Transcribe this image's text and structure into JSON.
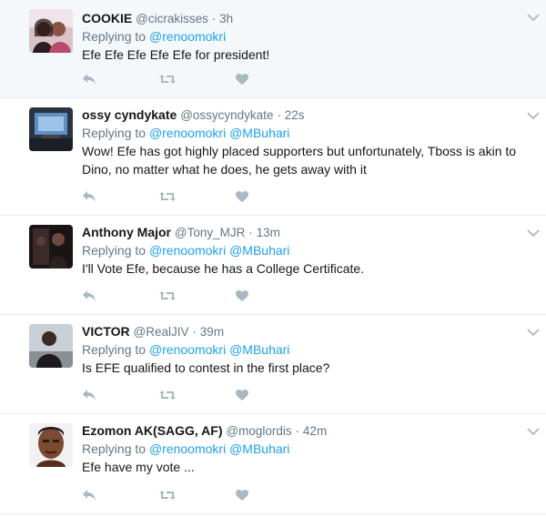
{
  "colors": {
    "link": "#1da1f2",
    "secondary": "#657786",
    "icon": "#aab8c2",
    "highlight_bg": "#f5f8fa"
  },
  "icons": {
    "reply": "reply-icon",
    "retweet": "retweet-icon",
    "like": "heart-icon",
    "more": "chevron-down-icon"
  },
  "tweets": [
    {
      "name": "COOKIE",
      "handle": "@cicrakisses",
      "separator": "·",
      "time": "3h",
      "replying_label": "Replying to",
      "mention1": "@renoomokri",
      "mention2": "",
      "text": "Efe Efe Efe Efe Efe for president!"
    },
    {
      "name": "ossy cyndykate",
      "handle": "@ossycyndykate",
      "separator": "·",
      "time": "22s",
      "replying_label": "Replying to",
      "mention1": "@renoomokri",
      "mention2": "@MBuhari",
      "text": "Wow! Efe has got highly placed supporters but unfortunately, Tboss is akin to Dino, no matter what he does, he gets away with it"
    },
    {
      "name": "Anthony Major",
      "handle": "@Tony_MJR",
      "separator": "·",
      "time": "13m",
      "replying_label": "Replying to",
      "mention1": "@renoomokri",
      "mention2": "@MBuhari",
      "text": "I'll Vote Efe, because he has a College Certificate."
    },
    {
      "name": "VICTOR",
      "handle": "@RealJIV",
      "separator": "·",
      "time": "39m",
      "replying_label": "Replying to",
      "mention1": "@renoomokri",
      "mention2": "@MBuhari",
      "text": "Is EFE qualified to contest in the first place?"
    },
    {
      "name": "Ezomon AK(SAGG, AF)",
      "handle": "@moglordis",
      "separator": "·",
      "time": "42m",
      "replying_label": "Replying to",
      "mention1": "@renoomokri",
      "mention2": "@MBuhari",
      "text": "Efe have my vote ..."
    }
  ]
}
